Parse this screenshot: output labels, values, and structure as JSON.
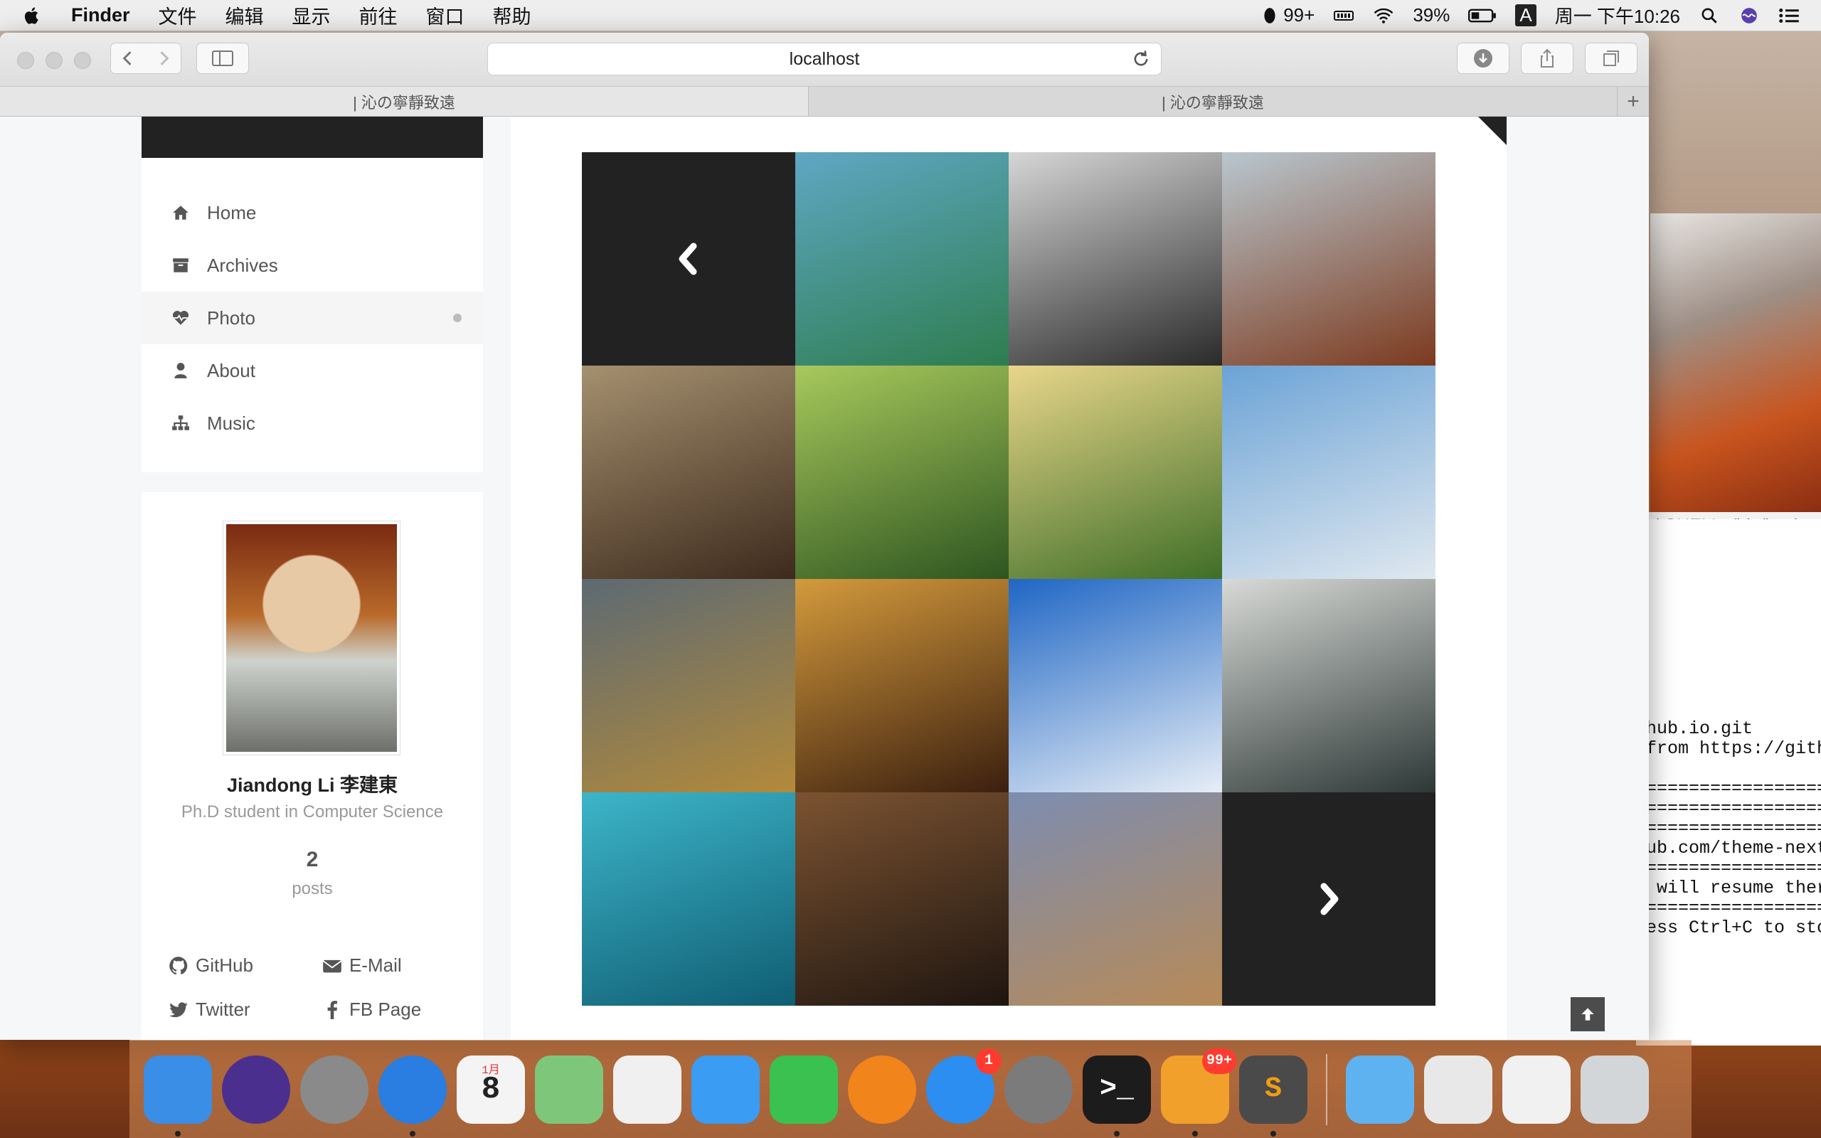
{
  "menubar": {
    "app_name": "Finder",
    "menus": [
      "文件",
      "编辑",
      "显示",
      "前往",
      "窗口",
      "帮助"
    ],
    "qq_badge": "99+",
    "battery_percent": "39%",
    "input_method": "A",
    "clock": "周一 下午10:26"
  },
  "browser": {
    "address": "localhost",
    "tabs": [
      {
        "label": "| 沁の寧靜致遠",
        "active": true
      },
      {
        "label": "| 沁の寧靜致遠",
        "active": false
      }
    ],
    "new_tab": "+"
  },
  "sidebar": {
    "items": [
      {
        "label": "Home",
        "icon": "home-icon",
        "active": false
      },
      {
        "label": "Archives",
        "icon": "archive-icon",
        "active": false
      },
      {
        "label": "Photo",
        "icon": "heartbeat-icon",
        "active": true
      },
      {
        "label": "About",
        "icon": "user-icon",
        "active": false
      },
      {
        "label": "Music",
        "icon": "sitemap-icon",
        "active": false
      }
    ]
  },
  "profile": {
    "name": "Jiandong Li 李建東",
    "description": "Ph.D student in Computer Science",
    "post_count": "2",
    "post_label": "posts",
    "links": [
      {
        "label": "GitHub",
        "icon": "github-icon"
      },
      {
        "label": "E-Mail",
        "icon": "envelope-icon"
      },
      {
        "label": "Twitter",
        "icon": "twitter-icon"
      },
      {
        "label": "FB Page",
        "icon": "facebook-icon"
      }
    ]
  },
  "gallery": {
    "photos": [
      {
        "name": "surfer",
        "colors": [
          "#5fa7c4",
          "#2e7d4f"
        ]
      },
      {
        "name": "portrait-man",
        "colors": [
          "#d6d6d6",
          "#2a2a2a"
        ]
      },
      {
        "name": "sea-rocks",
        "colors": [
          "#b9c7cf",
          "#7c3a1e"
        ]
      },
      {
        "name": "wooden-floor",
        "colors": [
          "#a5906f",
          "#3d2a1c"
        ]
      },
      {
        "name": "dragonfly-leaves",
        "colors": [
          "#a8c95c",
          "#2e5520"
        ]
      },
      {
        "name": "tree-sunset",
        "colors": [
          "#e8d68a",
          "#3f6e27"
        ]
      },
      {
        "name": "parasail",
        "colors": [
          "#6ba3d6",
          "#e0e8ef"
        ]
      },
      {
        "name": "golden-statue",
        "colors": [
          "#5d6a73",
          "#b38a3a"
        ]
      },
      {
        "name": "lantern",
        "colors": [
          "#d49a3c",
          "#3b1f0f"
        ]
      },
      {
        "name": "snow-mountain",
        "colors": [
          "#1f66c4",
          "#e7eef6"
        ]
      },
      {
        "name": "dog-sculpture",
        "colors": [
          "#d8dad7",
          "#2d3836"
        ]
      },
      {
        "name": "shark-aquarium",
        "colors": [
          "#3db5c9",
          "#0f5d73"
        ]
      },
      {
        "name": "skeletons",
        "colors": [
          "#7c5331",
          "#1e1510"
        ]
      },
      {
        "name": "shipwreck",
        "colors": [
          "#7d8db0",
          "#b78a57"
        ]
      }
    ]
  },
  "terminal": {
    "header": "al SHELL=/bin/bash",
    "lines": [
      {
        "text": "hub.io.git",
        "row": 0
      },
      {
        "text": "from https://githu",
        "row": 1
      },
      {
        "text": "==================",
        "row": 3
      },
      {
        "text": "==================",
        "row": 4
      },
      {
        "text": "==================",
        "row": 5
      },
      {
        "text": "ub.com/theme-next",
        "row": 6
      },
      {
        "text": "==================",
        "row": 7
      },
      {
        "text": " will resume there",
        "row": 8
      },
      {
        "text": "==================",
        "row": 9
      },
      {
        "text": "ess Ctrl+C to stop",
        "row": 10
      }
    ]
  },
  "dock": {
    "items": [
      {
        "name": "finder",
        "color": "#3a8ee6",
        "running": true
      },
      {
        "name": "siri",
        "color": "#4b2f8f",
        "running": false
      },
      {
        "name": "launchpad",
        "color": "#8a8a8a",
        "running": false
      },
      {
        "name": "safari",
        "color": "#2a7de1",
        "running": true
      },
      {
        "name": "calendar",
        "color": "#f4f4f4",
        "running": false,
        "text": "8",
        "month": "1月"
      },
      {
        "name": "maps",
        "color": "#7ec77a",
        "running": false
      },
      {
        "name": "photos",
        "color": "#f0f0f0",
        "running": false
      },
      {
        "name": "messages",
        "color": "#3a9cf2",
        "running": false
      },
      {
        "name": "facetime",
        "color": "#3ac150",
        "running": false
      },
      {
        "name": "ibooks",
        "color": "#f2841c",
        "running": false
      },
      {
        "name": "app-store",
        "color": "#2b8ef0",
        "running": false,
        "badge": "1"
      },
      {
        "name": "system-preferences",
        "color": "#7b7b7b",
        "running": false
      },
      {
        "name": "terminal",
        "color": "#1c1c1c",
        "running": true,
        "text": ">_"
      },
      {
        "name": "qq",
        "color": "#f1a12b",
        "running": true,
        "badge": "99+"
      },
      {
        "name": "sublime-text",
        "color": "#4a4a4a",
        "running": true,
        "text": "S"
      },
      {
        "name": "downloads-folder",
        "color": "#5eb2f0",
        "running": false
      },
      {
        "name": "recent-window-1",
        "color": "#e8e8e8",
        "running": false
      },
      {
        "name": "recent-window-2",
        "color": "#f1f1f1",
        "running": false
      },
      {
        "name": "trash",
        "color": "#d3d6d8",
        "running": false
      }
    ]
  }
}
